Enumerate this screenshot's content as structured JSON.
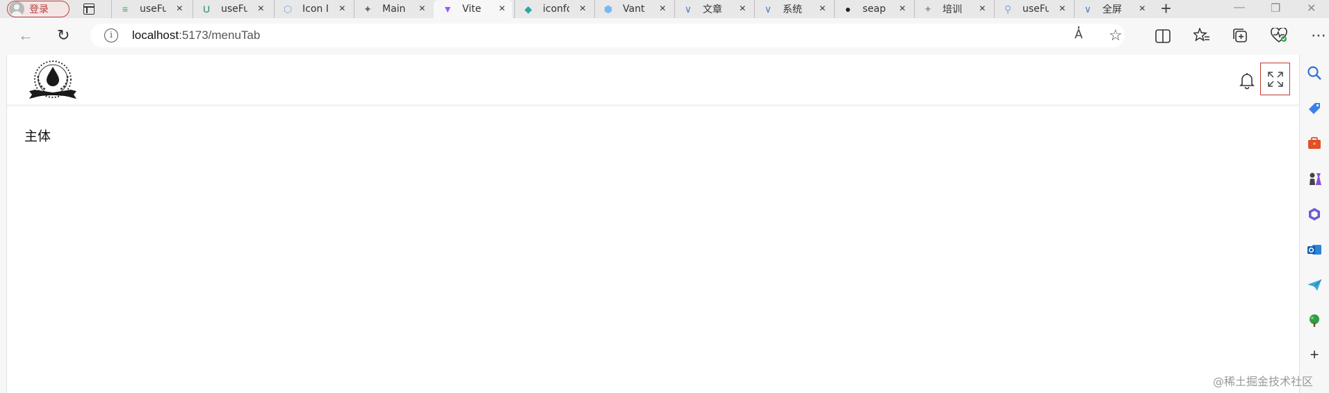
{
  "browser": {
    "profile_label": "登录",
    "tabs": [
      {
        "title": "useFu",
        "icon": "vite-edit-icon",
        "color": "#3aa757"
      },
      {
        "title": "useFu",
        "icon": "vueuse-icon",
        "color": "#1f8a70"
      },
      {
        "title": "Icon I",
        "icon": "hexagon-icon",
        "color": "#7fa8d8"
      },
      {
        "title": "Main",
        "icon": "bird-icon",
        "color": "#666666"
      },
      {
        "title": "Vite",
        "icon": "vite-icon",
        "color": "#9b59ff",
        "active": true
      },
      {
        "title": "iconfo",
        "icon": "iconfont-icon",
        "color": "#2aa7a0"
      },
      {
        "title": "Vant",
        "icon": "vant-icon",
        "color": "#7ab8f0"
      },
      {
        "title": "文章",
        "icon": "juejin-icon",
        "color": "#4a7bd8"
      },
      {
        "title": "系统",
        "icon": "juejin-icon",
        "color": "#4a7bd8"
      },
      {
        "title": "seap",
        "icon": "github-icon",
        "color": "#222222"
      },
      {
        "title": "培训",
        "icon": "bird-icon",
        "color": "#999999"
      },
      {
        "title": "useFu",
        "icon": "search-icon",
        "color": "#7fa8d8"
      },
      {
        "title": "全屏",
        "icon": "juejin-icon",
        "color": "#4a7bd8"
      }
    ],
    "close_glyph": "×",
    "new_tab_glyph": "+",
    "url_host": "localhost",
    "url_rest": ":5173/menuTab"
  },
  "page": {
    "main_text": "主体"
  },
  "watermark": "@稀土掘金技术社区",
  "colors": {
    "accent_red": "#c0392b",
    "profile_red": "#b8403c"
  }
}
